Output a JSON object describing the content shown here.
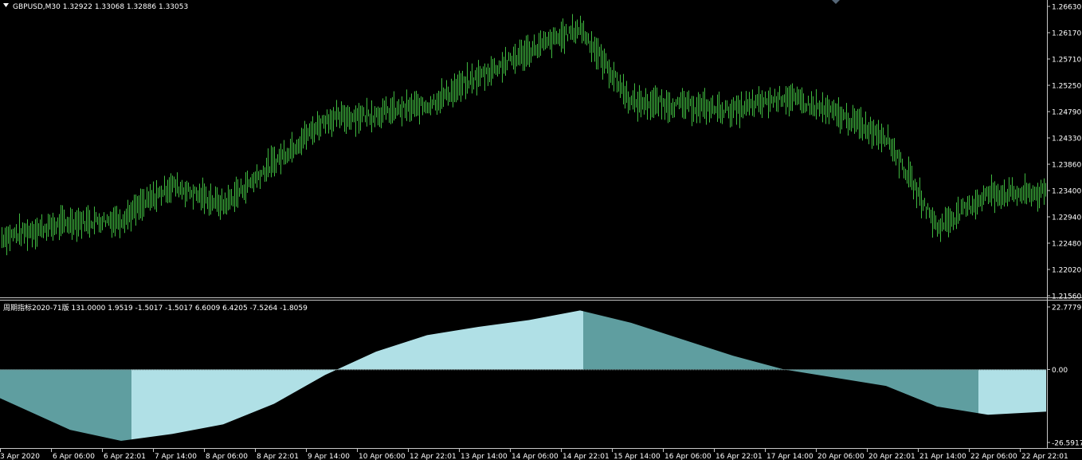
{
  "main_panel": {
    "header": "GBPUSD,M30  1.32922 1.33068 1.32886 1.33053",
    "price_labels": [
      "1.26630",
      "1.26170",
      "1.25710",
      "1.25250",
      "1.24790",
      "1.24330",
      "1.23860",
      "1.23400",
      "1.22940",
      "1.22480",
      "1.22020",
      "1.21560"
    ]
  },
  "indicator_panel": {
    "header": "周期指标2020-71版 131.0000 1.9519 -1.5017 -1.5017 6.6009 6.4205 -7.5264 -1.8059",
    "value_labels": [
      "22.7779",
      "0.00",
      "-26.5917"
    ]
  },
  "time_labels": [
    "3 Apr 2020",
    "6 Apr 06:00",
    "6 Apr 22:01",
    "7 Apr 14:00",
    "8 Apr 06:00",
    "8 Apr 22:01",
    "9 Apr 14:00",
    "10 Apr 06:00",
    "12 Apr 22:01",
    "13 Apr 14:00",
    "14 Apr 06:00",
    "14 Apr 22:01",
    "15 Apr 14:00",
    "16 Apr 06:00",
    "16 Apr 22:01",
    "17 Apr 14:00",
    "20 Apr 06:00",
    "20 Apr 22:01",
    "21 Apr 14:00",
    "22 Apr 06:00",
    "22 Apr 22:01"
  ],
  "colors": {
    "background": "#000000",
    "bar": "#3fb83f",
    "hist_light": "#b0e0e6",
    "hist_dark": "#5f9ea0",
    "axis": "#c8c8c8"
  },
  "chart_data": [
    {
      "type": "line",
      "title": "GBPUSD,M30",
      "ylim": [
        1.2156,
        1.2663
      ],
      "x": [
        "3 Apr 2020",
        "6 Apr 06:00",
        "6 Apr 22:01",
        "7 Apr 14:00",
        "8 Apr 06:00",
        "8 Apr 22:01",
        "9 Apr 14:00",
        "10 Apr 06:00",
        "12 Apr 22:01",
        "13 Apr 14:00",
        "14 Apr 06:00",
        "14 Apr 22:01",
        "15 Apr 14:00",
        "16 Apr 06:00",
        "16 Apr 22:01",
        "17 Apr 14:00",
        "20 Apr 06:00",
        "20 Apr 22:01",
        "21 Apr 14:00",
        "22 Apr 06:00",
        "22 Apr 22:01"
      ],
      "series": [
        {
          "values": [
            1.2265,
            1.2285,
            1.229,
            1.235,
            1.2315,
            1.239,
            1.2465,
            1.2475,
            1.249,
            1.254,
            1.2585,
            1.2625,
            1.2495,
            1.249,
            1.248,
            1.2505,
            1.2475,
            1.2435,
            1.2275,
            1.2335,
            1.2335
          ]
        }
      ]
    },
    {
      "type": "area",
      "title": "周期指标2020-71版",
      "ylim": [
        -26.5917,
        22.7779
      ],
      "x": [
        "3 Apr 2020",
        "6 Apr 06:00",
        "6 Apr 22:01",
        "7 Apr 14:00",
        "8 Apr 06:00",
        "8 Apr 22:01",
        "9 Apr 14:00",
        "10 Apr 06:00",
        "12 Apr 22:01",
        "13 Apr 14:00",
        "14 Apr 06:00",
        "14 Apr 22:01",
        "15 Apr 14:00",
        "16 Apr 06:00",
        "16 Apr 22:01",
        "17 Apr 14:00",
        "20 Apr 06:00",
        "20 Apr 22:01",
        "21 Apr 14:00",
        "22 Apr 06:00",
        "22 Apr 22:01"
      ],
      "series": [
        {
          "values": [
            -13.6,
            -22.0,
            -26.0,
            -23.5,
            -20.0,
            -12.5,
            -2.0,
            6.5,
            12.5,
            15.5,
            18.0,
            21.5,
            17.0,
            11.0,
            5.0,
            0.0,
            -3.0,
            -6.0,
            -13.5,
            -16.5,
            -15.5
          ]
        }
      ]
    }
  ]
}
